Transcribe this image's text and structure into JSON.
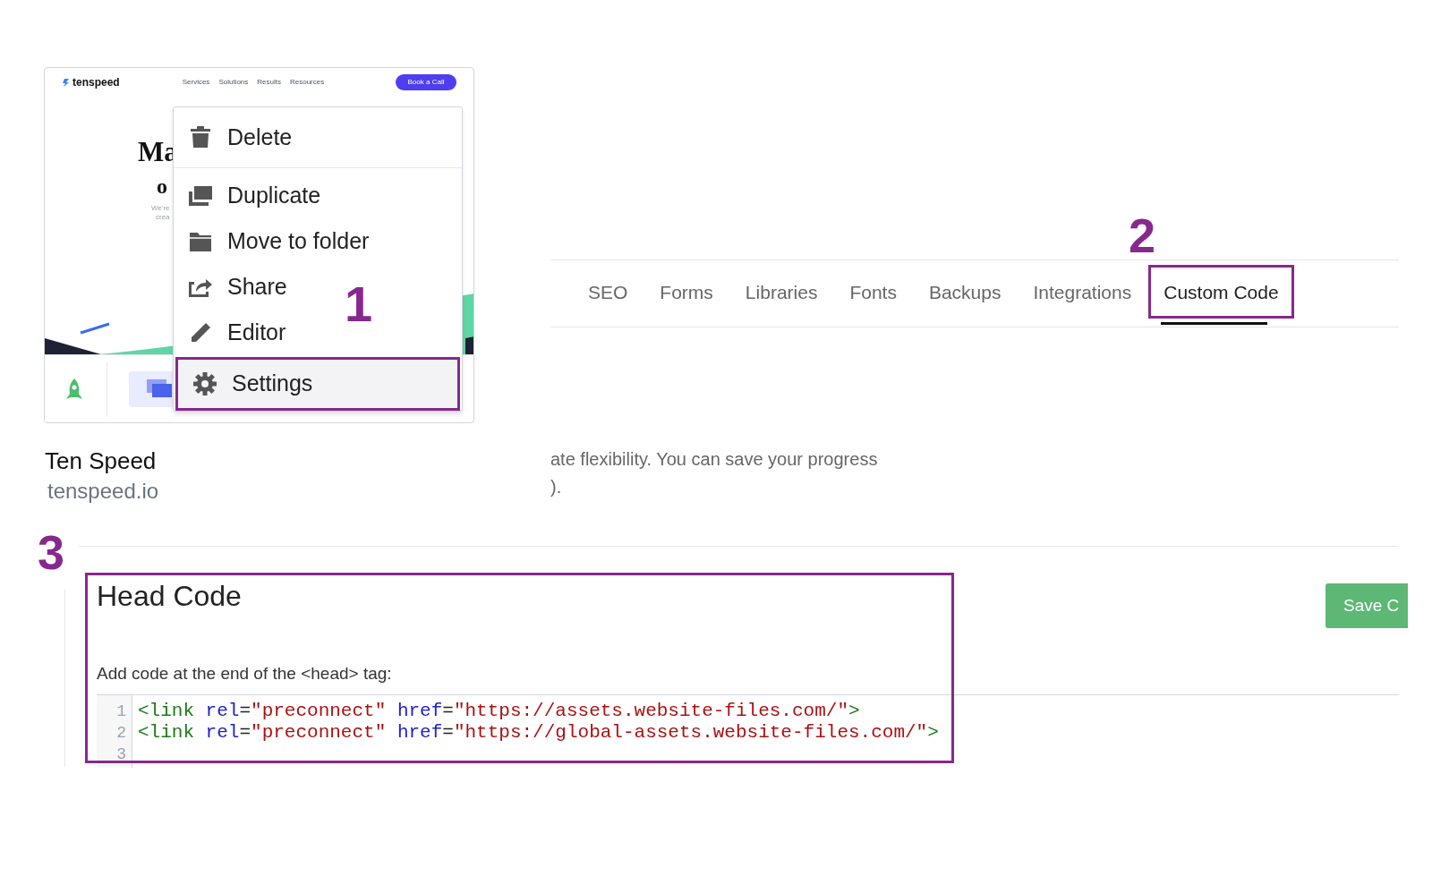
{
  "site_card": {
    "thumbnail": {
      "logo": "tenspeed",
      "nav": [
        "Services",
        "Solutions",
        "Results",
        "Resources"
      ],
      "cta": "Book a Call",
      "headline": [
        "Ma",
        "o"
      ],
      "body": [
        "We're",
        "crea"
      ]
    },
    "name": "Ten Speed",
    "domain": "tenspeed.io"
  },
  "context_menu": {
    "items": [
      {
        "label": "Delete",
        "divider_after": true,
        "selected": false,
        "annotated": false
      },
      {
        "label": "Duplicate",
        "divider_after": false,
        "selected": false,
        "annotated": false
      },
      {
        "label": "Move to folder",
        "divider_after": false,
        "selected": false,
        "annotated": false
      },
      {
        "label": "Share",
        "divider_after": false,
        "selected": false,
        "annotated": false
      },
      {
        "label": "Editor",
        "divider_after": false,
        "selected": false,
        "annotated": false
      },
      {
        "label": "Settings",
        "divider_after": false,
        "selected": true,
        "annotated": true
      }
    ]
  },
  "callouts": [
    "1",
    "2",
    "3"
  ],
  "tabs": [
    {
      "label": "SEO",
      "selected": false,
      "annotated": false
    },
    {
      "label": "Forms",
      "selected": false,
      "annotated": false
    },
    {
      "label": "Libraries",
      "selected": false,
      "annotated": false
    },
    {
      "label": "Fonts",
      "selected": false,
      "annotated": false
    },
    {
      "label": "Backups",
      "selected": false,
      "annotated": false
    },
    {
      "label": "Integrations",
      "selected": false,
      "annotated": false
    },
    {
      "label": "Custom Code",
      "selected": true,
      "annotated": true
    }
  ],
  "description_lines": [
    "ate flexibility. You can save your progress",
    ")."
  ],
  "head_code": {
    "title": "Head Code",
    "instruction": "Add code at the end of the <head> tag:",
    "annotated": true,
    "lines": [
      {
        "number": "1",
        "tokens": [
          {
            "kind": "tag",
            "text": "<link"
          },
          {
            "kind": "attr",
            "text": " rel"
          },
          {
            "kind": "punct",
            "text": "="
          },
          {
            "kind": "string",
            "text": "\"preconnect\""
          },
          {
            "kind": "attr",
            "text": " href"
          },
          {
            "kind": "punct",
            "text": "="
          },
          {
            "kind": "string",
            "text": "\"https://assets.website-files.com/\""
          },
          {
            "kind": "tag",
            "text": ">"
          }
        ]
      },
      {
        "number": "2",
        "tokens": [
          {
            "kind": "tag",
            "text": "<link"
          },
          {
            "kind": "attr",
            "text": " rel"
          },
          {
            "kind": "punct",
            "text": "="
          },
          {
            "kind": "string",
            "text": "\"preconnect\""
          },
          {
            "kind": "attr",
            "text": " href"
          },
          {
            "kind": "punct",
            "text": "="
          },
          {
            "kind": "string",
            "text": "\"https://global-assets.website-files.com/\""
          },
          {
            "kind": "tag",
            "text": ">"
          }
        ]
      },
      {
        "number": "3"
      }
    ]
  },
  "save_button": "Save C"
}
